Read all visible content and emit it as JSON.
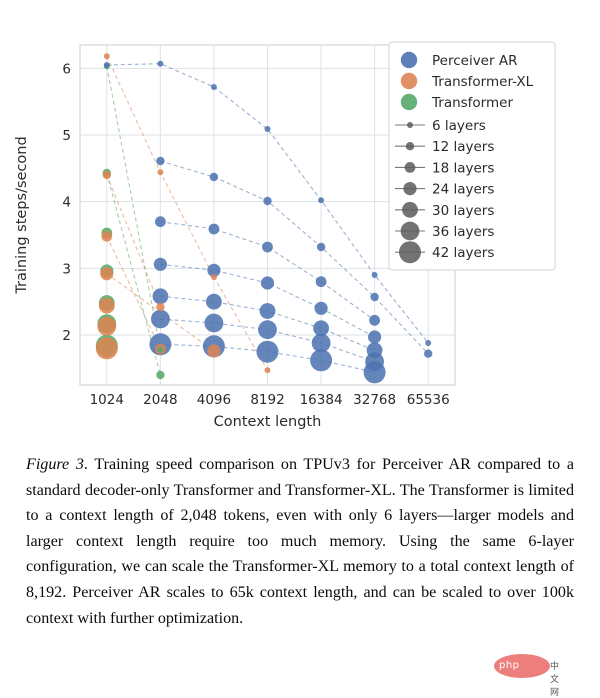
{
  "figure": {
    "axes": {
      "xlabel": "Context length",
      "ylabel": "Training steps/second",
      "xticks": [
        "1024",
        "2048",
        "4096",
        "8192",
        "16384",
        "32768",
        "65536"
      ],
      "yticks": [
        "2",
        "3",
        "4",
        "5",
        "6"
      ]
    },
    "legend": {
      "model_entries": [
        {
          "label": "Perceiver AR",
          "color": "#4c72b0"
        },
        {
          "label": "Transformer-XL",
          "color": "#dd8452"
        },
        {
          "label": "Transformer",
          "color": "#55a868"
        }
      ],
      "size_entries": [
        {
          "label": "6 layers",
          "size": 3.0
        },
        {
          "label": "12 layers",
          "size": 4.2
        },
        {
          "label": "18 layers",
          "size": 5.4
        },
        {
          "label": "24 layers",
          "size": 6.6
        },
        {
          "label": "30 layers",
          "size": 7.9
        },
        {
          "label": "36 layers",
          "size": 9.4
        },
        {
          "label": "42 layers",
          "size": 11.0
        }
      ]
    }
  },
  "chart_data": {
    "type": "scatter",
    "title": "",
    "xlabel": "Context length",
    "ylabel": "Training steps/second",
    "xscale": "log2-categorical",
    "x_categories": [
      1024,
      2048,
      4096,
      8192,
      16384,
      32768,
      65536
    ],
    "xticklabels": [
      "1024",
      "2048",
      "4096",
      "8192",
      "16384",
      "32768",
      "65536"
    ],
    "ylim": [
      1.25,
      6.35
    ],
    "yticks": [
      2,
      3,
      4,
      5,
      6
    ],
    "grid": true,
    "legend_position": "upper right",
    "size_encodes": "number of layers",
    "size_levels": [
      6,
      12,
      18,
      24,
      30,
      36,
      42
    ],
    "series": [
      {
        "name": "Perceiver AR",
        "color": "#4c72b0",
        "points": [
          {
            "x": 1024,
            "y": 6.05,
            "layers": 6
          },
          {
            "x": 2048,
            "y": 6.07,
            "layers": 6
          },
          {
            "x": 4096,
            "y": 5.72,
            "layers": 6
          },
          {
            "x": 8192,
            "y": 5.09,
            "layers": 6
          },
          {
            "x": 16384,
            "y": 4.02,
            "layers": 6
          },
          {
            "x": 32768,
            "y": 2.9,
            "layers": 6
          },
          {
            "x": 65536,
            "y": 1.88,
            "layers": 6
          },
          {
            "x": 2048,
            "y": 4.61,
            "layers": 12
          },
          {
            "x": 4096,
            "y": 4.37,
            "layers": 12
          },
          {
            "x": 8192,
            "y": 4.01,
            "layers": 12
          },
          {
            "x": 16384,
            "y": 3.32,
            "layers": 12
          },
          {
            "x": 32768,
            "y": 2.57,
            "layers": 12
          },
          {
            "x": 65536,
            "y": 1.72,
            "layers": 12
          },
          {
            "x": 2048,
            "y": 3.7,
            "layers": 18
          },
          {
            "x": 4096,
            "y": 3.59,
            "layers": 18
          },
          {
            "x": 8192,
            "y": 3.32,
            "layers": 18
          },
          {
            "x": 16384,
            "y": 2.8,
            "layers": 18
          },
          {
            "x": 32768,
            "y": 2.22,
            "layers": 18
          },
          {
            "x": 2048,
            "y": 3.06,
            "layers": 24
          },
          {
            "x": 4096,
            "y": 2.97,
            "layers": 24
          },
          {
            "x": 8192,
            "y": 2.78,
            "layers": 24
          },
          {
            "x": 16384,
            "y": 2.4,
            "layers": 24
          },
          {
            "x": 32768,
            "y": 1.97,
            "layers": 24
          },
          {
            "x": 2048,
            "y": 2.58,
            "layers": 30
          },
          {
            "x": 4096,
            "y": 2.5,
            "layers": 30
          },
          {
            "x": 8192,
            "y": 2.36,
            "layers": 30
          },
          {
            "x": 16384,
            "y": 2.1,
            "layers": 30
          },
          {
            "x": 32768,
            "y": 1.77,
            "layers": 30
          },
          {
            "x": 2048,
            "y": 2.24,
            "layers": 36
          },
          {
            "x": 4096,
            "y": 2.18,
            "layers": 36
          },
          {
            "x": 8192,
            "y": 2.08,
            "layers": 36
          },
          {
            "x": 16384,
            "y": 1.88,
            "layers": 36
          },
          {
            "x": 32768,
            "y": 1.6,
            "layers": 36
          },
          {
            "x": 2048,
            "y": 1.86,
            "layers": 42
          },
          {
            "x": 4096,
            "y": 1.83,
            "layers": 42
          },
          {
            "x": 8192,
            "y": 1.75,
            "layers": 42
          },
          {
            "x": 16384,
            "y": 1.62,
            "layers": 42
          },
          {
            "x": 32768,
            "y": 1.44,
            "layers": 42
          }
        ]
      },
      {
        "name": "Transformer-XL",
        "color": "#dd8452",
        "points": [
          {
            "x": 1024,
            "y": 6.18,
            "layers": 6
          },
          {
            "x": 2048,
            "y": 4.44,
            "layers": 6
          },
          {
            "x": 4096,
            "y": 2.87,
            "layers": 6
          },
          {
            "x": 8192,
            "y": 1.47,
            "layers": 6
          },
          {
            "x": 1024,
            "y": 4.4,
            "layers": 12
          },
          {
            "x": 2048,
            "y": 2.42,
            "layers": 12
          },
          {
            "x": 1024,
            "y": 3.48,
            "layers": 18
          },
          {
            "x": 2048,
            "y": 1.79,
            "layers": 18
          },
          {
            "x": 1024,
            "y": 2.92,
            "layers": 24
          },
          {
            "x": 1024,
            "y": 2.44,
            "layers": 30
          },
          {
            "x": 1024,
            "y": 2.13,
            "layers": 36
          },
          {
            "x": 1024,
            "y": 1.8,
            "layers": 42
          },
          {
            "x": 4096,
            "y": 1.76,
            "layers": 24
          }
        ]
      },
      {
        "name": "Transformer",
        "color": "#55a868",
        "points": [
          {
            "x": 1024,
            "y": 6.03,
            "layers": 6
          },
          {
            "x": 1024,
            "y": 4.43,
            "layers": 12
          },
          {
            "x": 1024,
            "y": 3.53,
            "layers": 18
          },
          {
            "x": 1024,
            "y": 2.96,
            "layers": 24
          },
          {
            "x": 1024,
            "y": 2.48,
            "layers": 30
          },
          {
            "x": 1024,
            "y": 2.17,
            "layers": 36
          },
          {
            "x": 1024,
            "y": 1.84,
            "layers": 42
          },
          {
            "x": 2048,
            "y": 1.78,
            "layers": 6
          },
          {
            "x": 2048,
            "y": 1.4,
            "layers": 12
          }
        ]
      }
    ]
  },
  "caption": {
    "figure_number": "Figure 3",
    "text": ". Training speed comparison on TPUv3 for Perceiver AR compared to a standard decoder-only Transformer and Transformer-XL. The Transformer is limited to a context length of 2,048 tokens, even with only 6 layers—larger models and larger context length require too much memory. Using the same 6-layer configuration, we can scale the Transformer-XL memory to a total context length of 8,192. Perceiver AR scales to 65k context length, and can be scaled to over 100k context with further optimization."
  },
  "watermark": {
    "brand": "php",
    "suffix": "中文网"
  }
}
